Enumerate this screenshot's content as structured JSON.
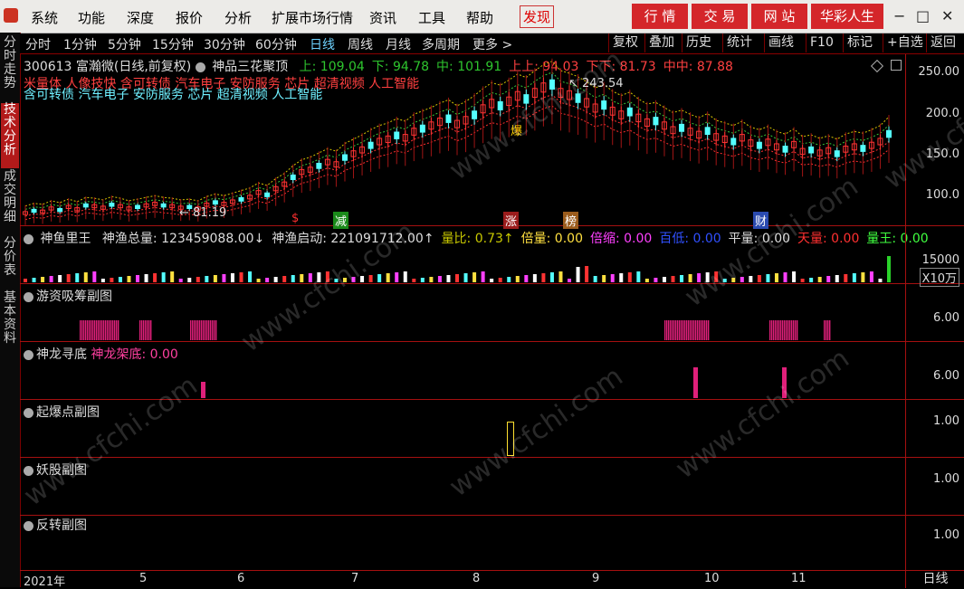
{
  "menu": {
    "items": [
      "系统",
      "功能",
      "深度",
      "报价",
      "分析",
      "扩展市场行情",
      "资讯",
      "工具",
      "帮助"
    ],
    "find": "发现"
  },
  "brand_buttons": [
    "行 情",
    "交 易",
    "网 站",
    "华彩人生"
  ],
  "window_controls": [
    "−",
    "□",
    "✕"
  ],
  "left_tabs": [
    "分时走势",
    "技术分析",
    "成交明细",
    "分价表",
    "基本资料"
  ],
  "toolbar": {
    "periods": [
      "分时",
      "1分钟",
      "5分钟",
      "15分钟",
      "30分钟",
      "60分钟",
      "日线",
      "周线",
      "月线",
      "多周期",
      "更多 >"
    ],
    "active": "日线",
    "right": [
      "复权",
      "叠加",
      "历史",
      "统计",
      "画线",
      "F10",
      "标记",
      "+自选",
      "返回"
    ]
  },
  "main": {
    "stock": "300613 富瀚微(日线,前复权)",
    "indicator": "神品三花聚顶",
    "params": [
      {
        "label": "上: 109.04",
        "color": "#2ec52e"
      },
      {
        "label": "下: 94.78",
        "color": "#2ec52e"
      },
      {
        "label": "中: 101.91",
        "color": "#2ec52e"
      },
      {
        "label": "上上: 94.03",
        "color": "#ff4040"
      },
      {
        "label": "下下: 81.73",
        "color": "#ff4040"
      },
      {
        "label": "中中: 87.88",
        "color": "#ff4040"
      }
    ],
    "concepts_red": "米量体 人像技快 含可转债 汽车电子 安防服务 芯片 超清视频 人工智能",
    "concepts_cyan": "含可转债 汽车电子 安防服务 芯片 超清视频 人工智能",
    "high_label": "243.54",
    "low_label": "81.19",
    "yaxis": [
      "250.00",
      "200.0",
      "150.0",
      "100.0"
    ],
    "signals": [
      {
        "text": "$",
        "color": "#ff3030",
        "bg": "none"
      },
      {
        "text": "减",
        "color": "#fff",
        "bg": "#1a8a1a"
      },
      {
        "text": "涨",
        "color": "#fff",
        "bg": "#9b1c1c"
      },
      {
        "text": "榜",
        "color": "#fff",
        "bg": "#9b5c1c"
      },
      {
        "text": "财",
        "color": "#fff",
        "bg": "#2a4ab0"
      },
      {
        "text": "爆",
        "color": "#ffd000",
        "bg": "none"
      }
    ]
  },
  "volume": {
    "title": "神鱼里王",
    "items": [
      {
        "label": "神渔总量: 123459088.00↓",
        "color": "#ddd"
      },
      {
        "label": "神渔启动: 221091712.00↑",
        "color": "#ddd"
      },
      {
        "label": "量比: 0.73↑",
        "color": "#c8c800"
      },
      {
        "label": "倍量: 0.00",
        "color": "#ffe040"
      },
      {
        "label": "倍缩: 0.00",
        "color": "#ff40ff"
      },
      {
        "label": "百低: 0.00",
        "color": "#3050ff"
      },
      {
        "label": "平量: 0.00",
        "color": "#ddd"
      },
      {
        "label": "天量: 0.00",
        "color": "#ff3030"
      },
      {
        "label": "量王: 0.00",
        "color": "#40ff40"
      }
    ],
    "yaxis": [
      "15000",
      "X10万"
    ]
  },
  "sub1": {
    "title": "游资吸筹副图",
    "axis": "6.00"
  },
  "sub2": {
    "title": "神龙寻底",
    "extra": "神龙架底: 0.00",
    "axis": "6.00"
  },
  "sub3": {
    "title": "起爆点副图",
    "axis": "1.00"
  },
  "sub4": {
    "title": "妖股副图",
    "axis": "1.00"
  },
  "sub5": {
    "title": "反转副图",
    "axis": "1.00"
  },
  "bottom": {
    "months": [
      "2021年",
      "5",
      "6",
      "7",
      "8",
      "9",
      "10",
      "11"
    ],
    "period": "日线"
  },
  "watermark": "www.cfchi.com",
  "colors": {
    "up": "#ff3333",
    "down": "#54ffff",
    "panel_border": "#a51010",
    "ma_yellow": "#d6c600",
    "ma_green": "#37c837"
  },
  "price_series": [
    74,
    77,
    76,
    80,
    78,
    82,
    79,
    84,
    83,
    81,
    85,
    83,
    80,
    82,
    84,
    86,
    84,
    83,
    81,
    82,
    80,
    85,
    88,
    86,
    89,
    92,
    95,
    101,
    98,
    106,
    112,
    121,
    128,
    131,
    136,
    141,
    138,
    147,
    152,
    157,
    163,
    168,
    171,
    176,
    173,
    181,
    185,
    189,
    194,
    198,
    191,
    196,
    203,
    211,
    218,
    215,
    221,
    228,
    224,
    232,
    239,
    243,
    232,
    229,
    225,
    219,
    212,
    216,
    208,
    203,
    207,
    199,
    193,
    195,
    189,
    183,
    186,
    181,
    177,
    182,
    174,
    171,
    168,
    173,
    166,
    163,
    167,
    161,
    158,
    164,
    155,
    157,
    153,
    156,
    152,
    158,
    161,
    159,
    163,
    168,
    178
  ]
}
